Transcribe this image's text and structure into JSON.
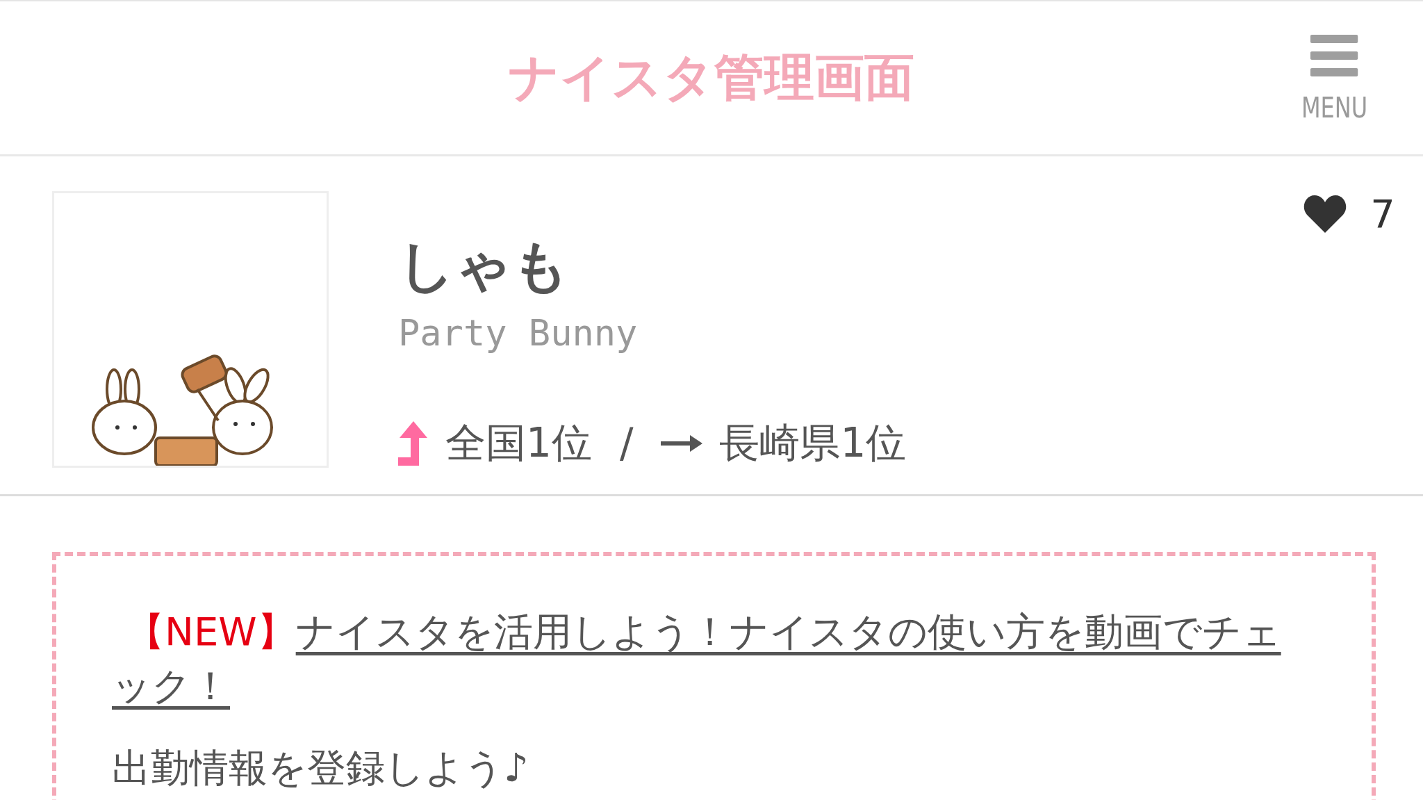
{
  "header": {
    "title": "ナイスタ管理画面",
    "menu_label": "MENU"
  },
  "profile": {
    "name": "しゃも",
    "shop": "Party Bunny",
    "likes": "7",
    "ranks": [
      {
        "label": "全国1位",
        "kind": "up"
      },
      {
        "label": "長崎県1位",
        "kind": "flat"
      }
    ],
    "separator": "/"
  },
  "notices": [
    {
      "kind": "link",
      "tag": "【NEW】",
      "text": "ナイスタを活用しよう！ナイスタの使い方を動画でチェック！"
    },
    {
      "kind": "plain",
      "text": "出勤情報を登録しよう♪"
    }
  ]
}
